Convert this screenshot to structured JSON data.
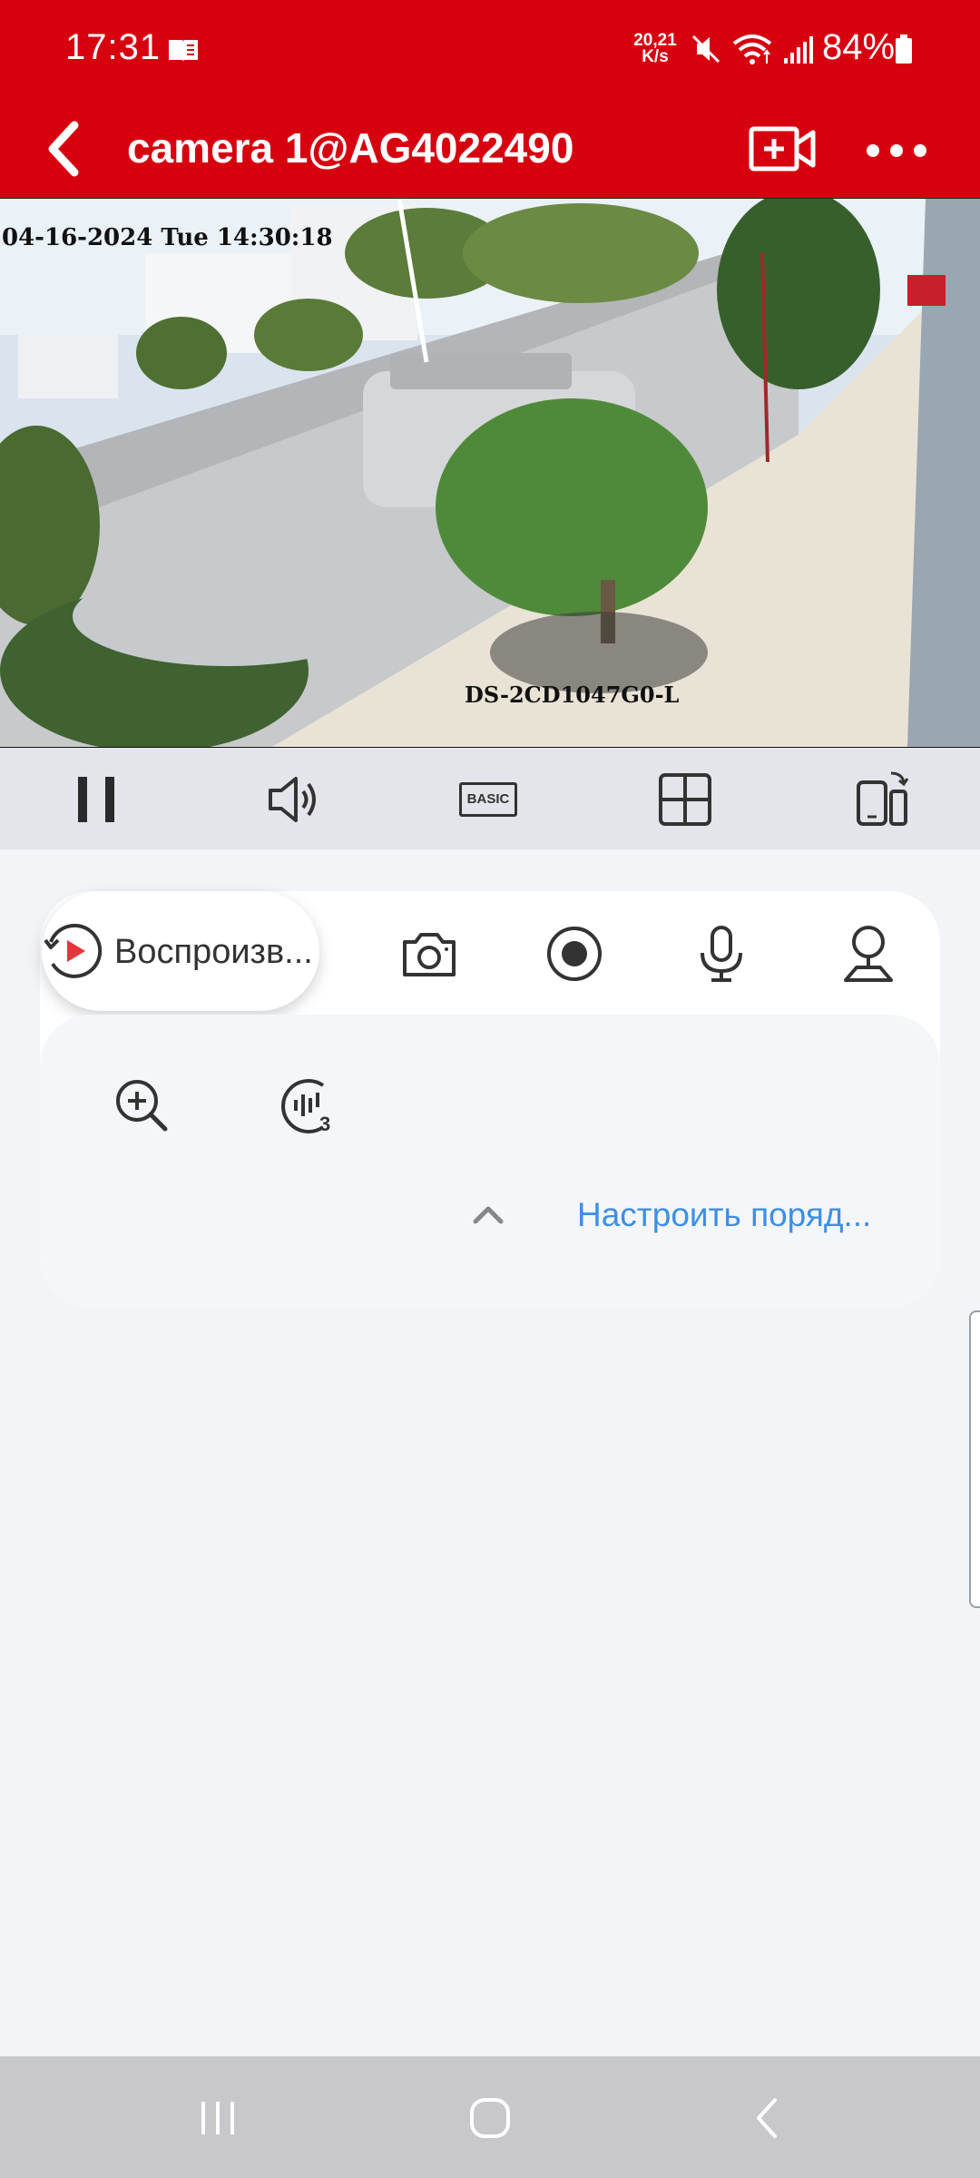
{
  "status_bar": {
    "time": "17:31",
    "net_speed_value": "20,21",
    "net_speed_unit": "K/s",
    "battery_percent": "84%",
    "icons": [
      "reader-mode-icon",
      "mute-icon",
      "wifi-icon",
      "signal-icon",
      "battery-icon"
    ]
  },
  "app_bar": {
    "title": "camera 1@AG4022490",
    "icons": [
      "back-icon",
      "add-recording-icon",
      "more-icon"
    ]
  },
  "video": {
    "osd_datetime": "04-16-2024 Tue 14:30:18",
    "osd_model": "DS-2CD1047G0-L"
  },
  "toolbar": {
    "quality_label": "BASIC",
    "icons": [
      "pause-icon",
      "speaker-icon",
      "quality-icon",
      "grid-layout-icon",
      "rotate-screen-icon"
    ]
  },
  "feature_panel": {
    "playback_label": "Воспроизв...",
    "row1_icons": [
      "playback-icon",
      "camera-snapshot-icon",
      "record-icon",
      "microphone-icon",
      "ptz-icon"
    ],
    "row2_icons": [
      "zoom-in-icon",
      "audio-3-icon"
    ],
    "customize_label": "Настроить поряд..."
  },
  "nav_bar": {
    "icons": [
      "recent-apps-icon",
      "home-icon",
      "back-nav-icon"
    ]
  },
  "colors": {
    "brand_red": "#d7000f",
    "accent_blue": "#3d8fe6",
    "playback_red": "#e5363f"
  }
}
